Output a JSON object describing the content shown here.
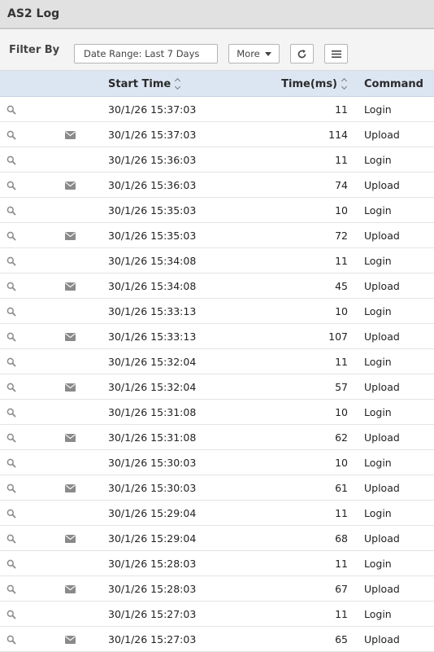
{
  "window": {
    "title": "AS2 Log"
  },
  "toolbar": {
    "filter_label": "Filter By",
    "date_range": "Date Range: Last 7 Days",
    "more_label": "More",
    "refresh_icon": "refresh-icon",
    "menu_icon": "hamburger-menu-icon"
  },
  "table": {
    "columns": {
      "start_time": "Start Time",
      "time_ms": "Time(ms)",
      "command": "Command"
    },
    "rows": [
      {
        "start_time": "30/1/26 15:37:03",
        "time_ms": "11",
        "command": "Login",
        "has_message": false
      },
      {
        "start_time": "30/1/26 15:37:03",
        "time_ms": "114",
        "command": "Upload",
        "has_message": true
      },
      {
        "start_time": "30/1/26 15:36:03",
        "time_ms": "11",
        "command": "Login",
        "has_message": false
      },
      {
        "start_time": "30/1/26 15:36:03",
        "time_ms": "74",
        "command": "Upload",
        "has_message": true
      },
      {
        "start_time": "30/1/26 15:35:03",
        "time_ms": "10",
        "command": "Login",
        "has_message": false
      },
      {
        "start_time": "30/1/26 15:35:03",
        "time_ms": "72",
        "command": "Upload",
        "has_message": true
      },
      {
        "start_time": "30/1/26 15:34:08",
        "time_ms": "11",
        "command": "Login",
        "has_message": false
      },
      {
        "start_time": "30/1/26 15:34:08",
        "time_ms": "45",
        "command": "Upload",
        "has_message": true
      },
      {
        "start_time": "30/1/26 15:33:13",
        "time_ms": "10",
        "command": "Login",
        "has_message": false
      },
      {
        "start_time": "30/1/26 15:33:13",
        "time_ms": "107",
        "command": "Upload",
        "has_message": true
      },
      {
        "start_time": "30/1/26 15:32:04",
        "time_ms": "11",
        "command": "Login",
        "has_message": false
      },
      {
        "start_time": "30/1/26 15:32:04",
        "time_ms": "57",
        "command": "Upload",
        "has_message": true
      },
      {
        "start_time": "30/1/26 15:31:08",
        "time_ms": "10",
        "command": "Login",
        "has_message": false
      },
      {
        "start_time": "30/1/26 15:31:08",
        "time_ms": "62",
        "command": "Upload",
        "has_message": true
      },
      {
        "start_time": "30/1/26 15:30:03",
        "time_ms": "10",
        "command": "Login",
        "has_message": false
      },
      {
        "start_time": "30/1/26 15:30:03",
        "time_ms": "61",
        "command": "Upload",
        "has_message": true
      },
      {
        "start_time": "30/1/26 15:29:04",
        "time_ms": "11",
        "command": "Login",
        "has_message": false
      },
      {
        "start_time": "30/1/26 15:29:04",
        "time_ms": "68",
        "command": "Upload",
        "has_message": true
      },
      {
        "start_time": "30/1/26 15:28:03",
        "time_ms": "11",
        "command": "Login",
        "has_message": false
      },
      {
        "start_time": "30/1/26 15:28:03",
        "time_ms": "67",
        "command": "Upload",
        "has_message": true
      },
      {
        "start_time": "30/1/26 15:27:03",
        "time_ms": "11",
        "command": "Login",
        "has_message": false
      },
      {
        "start_time": "30/1/26 15:27:03",
        "time_ms": "65",
        "command": "Upload",
        "has_message": true
      }
    ]
  },
  "colors": {
    "title_bar": "#e1e1e1",
    "header_row": "#dce6f2",
    "icon": "#8a8a8a"
  }
}
